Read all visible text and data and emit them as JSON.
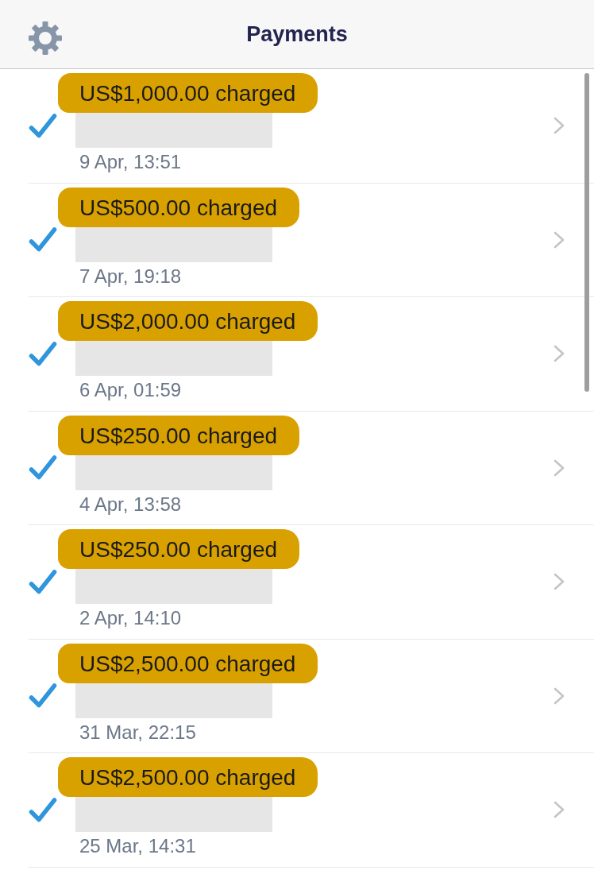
{
  "header": {
    "title": "Payments"
  },
  "payments": [
    {
      "amount": "US$1,000.00 charged",
      "highlighted": true,
      "date": "9 Apr, 13:51",
      "checked": true
    },
    {
      "amount": "US$500.00 charged",
      "highlighted": true,
      "date": "7 Apr, 19:18",
      "checked": true
    },
    {
      "amount": "US$2,000.00 charged",
      "highlighted": true,
      "date": "6 Apr, 01:59",
      "checked": true
    },
    {
      "amount": "US$250.00 charged",
      "highlighted": true,
      "date": "4 Apr, 13:58",
      "checked": true
    },
    {
      "amount": "US$250.00 charged",
      "highlighted": true,
      "date": "2 Apr, 14:10",
      "checked": true
    },
    {
      "amount": "US$2,500.00 charged",
      "highlighted": true,
      "date": "31 Mar, 22:15",
      "checked": true
    },
    {
      "amount": "US$2,500.00 charged",
      "highlighted": true,
      "date": "25 Mar, 14:31",
      "checked": true
    }
  ]
}
